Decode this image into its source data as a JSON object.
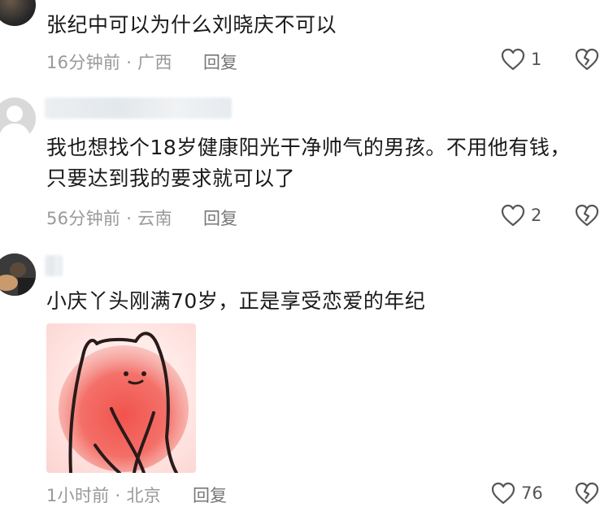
{
  "comments": [
    {
      "text": "张纪中可以为什么刘晓庆不可以",
      "time_location": "16分钟前 · 广西",
      "reply_label": "回复",
      "likes": "1"
    },
    {
      "text": "我也想找个18岁健康阳光干净帅气的男孩。不用他有钱，只要达到我的要求就可以了",
      "time_location": "56分钟前 · 云南",
      "reply_label": "回复",
      "likes": "2"
    },
    {
      "text": "小庆丫头刚满70岁，正是享受恋爱的年纪",
      "time_location": "1小时前 · 北京",
      "reply_label": "回复",
      "likes": "76"
    }
  ],
  "colors": {
    "meta": "#999999",
    "icon": "#555555",
    "sticker_blob": "#e85a4f"
  },
  "icons": [
    "heart-icon",
    "broken-heart-icon",
    "avatar",
    "sticker-image"
  ]
}
